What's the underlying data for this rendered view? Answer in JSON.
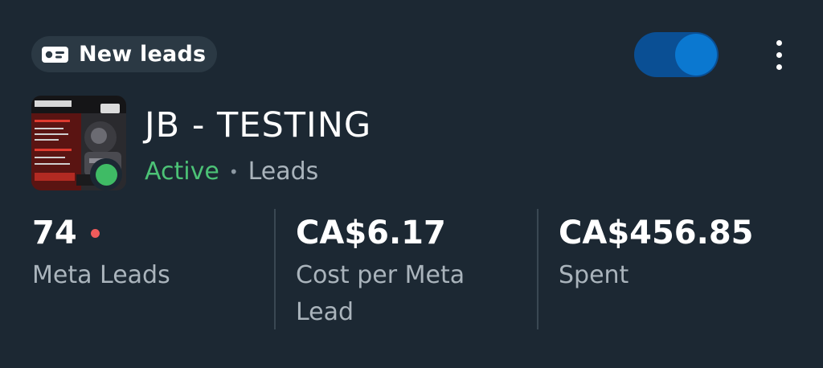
{
  "badge": {
    "icon": "lead-form-icon",
    "label": "New leads"
  },
  "toggle": {
    "state": "on",
    "color": "#0b78d0"
  },
  "menu": {
    "icon": "more-vertical-icon"
  },
  "ad": {
    "name": "JB - TESTING",
    "status": "Active",
    "separator": "•",
    "type": "Leads",
    "status_color": "#4cc276"
  },
  "metrics": [
    {
      "value": "74",
      "label": "Meta Leads",
      "alert": true,
      "alert_color": "#ef5b5b"
    },
    {
      "value": "CA$6.17",
      "label": "Cost per Meta Lead"
    },
    {
      "value": "CA$456.85",
      "label": "Spent"
    }
  ]
}
